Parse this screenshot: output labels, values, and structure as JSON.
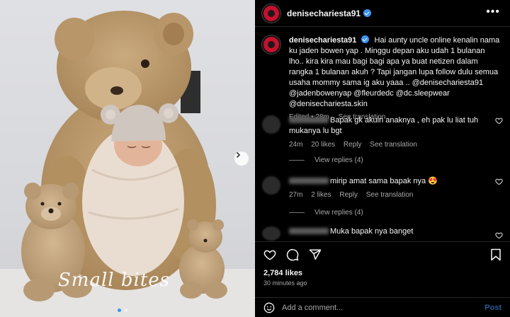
{
  "post": {
    "username": "denisechariesta91",
    "caption_text": "Hai aunty uncle online kenalin nama ku jaden bowen yap . Minggu depan aku udah 1 bulanan lho.. kira kira mau bagi bagi apa ya buat netizen dalam rangka 1 bulanan akuh ? Tapi jangan lupa follow dulu semua usaha mommy sama ig aku yaaa .. @denisechariesta91 @jadenbowenyap @fleurdedc @dc.sleepwear @denisechariesta.skin",
    "caption_meta": {
      "edited": "Edited • 28m",
      "see_translation": "See translation"
    },
    "likes": "2,784 likes",
    "posted": "30 minutes ago",
    "photo_watermark": "Small bites"
  },
  "comments": [
    {
      "text": "Bapak gk akuin anaknya , eh pak lu liat tuh mukanya lu bgt",
      "time": "24m",
      "likes": "20 likes",
      "reply": "Reply",
      "see_translation": "See translation",
      "view_replies": "View replies (4)"
    },
    {
      "text": "mirip amat sama bapak nya 😍",
      "time": "27m",
      "likes": "2 likes",
      "reply": "Reply",
      "see_translation": "See translation",
      "view_replies": "View replies (4)"
    },
    {
      "text": "Muka bapak nya banget"
    }
  ],
  "input": {
    "placeholder": "Add a comment...",
    "post_label": "Post"
  },
  "icons": [
    "more-icon",
    "verified-icon",
    "heart-icon",
    "comment-icon",
    "share-icon",
    "bookmark-icon",
    "emoji-icon",
    "chevron-right-icon"
  ],
  "colors": {
    "background": "#000000",
    "accent": "#3b95f6",
    "muted_text": "#a8a8a8",
    "post_button": "#1d5c99"
  }
}
